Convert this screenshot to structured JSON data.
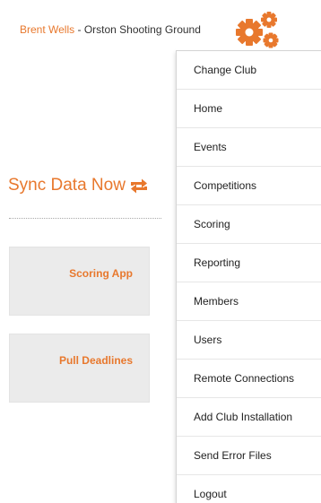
{
  "header": {
    "user_name": "Brent Wells",
    "separator": " - ",
    "club_name": "Orston Shooting Ground",
    "settings_icon": "gears-icon"
  },
  "sync": {
    "label": "Sync Data Now",
    "icon": "sync-arrows-icon"
  },
  "tiles": {
    "scoring_app": "Scoring App",
    "pull_deadlines": "Pull Deadlines"
  },
  "menu": {
    "items": [
      "Change Club",
      "Home",
      "Events",
      "Competitions",
      "Scoring",
      "Reporting",
      "Members",
      "Users",
      "Remote Connections",
      "Add Club Installation",
      "Send Error Files",
      "Logout"
    ]
  },
  "colors": {
    "accent": "#e8782d",
    "tile_bg": "#ebebeb",
    "text": "#222222"
  }
}
